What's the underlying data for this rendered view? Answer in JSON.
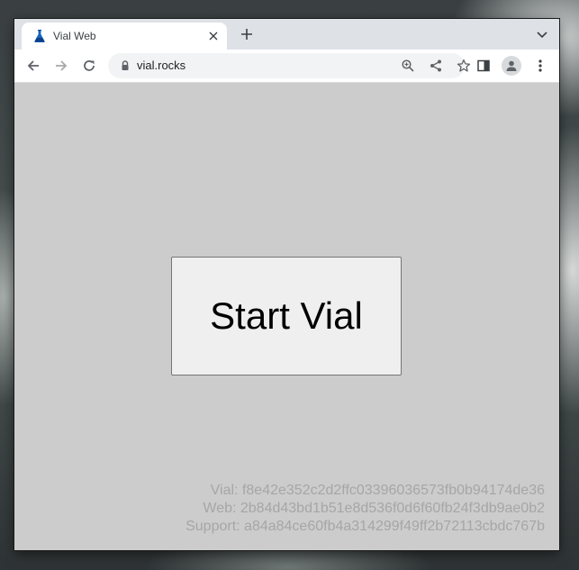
{
  "browser": {
    "tab": {
      "title": "Vial Web",
      "favicon": "flask-icon"
    },
    "address_bar": {
      "url": "vial.rocks"
    },
    "colors": {
      "tab_strip": "#dee1e6",
      "toolbar": "#ffffff",
      "icon": "#5f6368"
    }
  },
  "page": {
    "background": "#cccccc",
    "start_button_label": "Start Vial",
    "versions": [
      {
        "label": "Vial: f8e42e352c2d2ffc03396036573fb0b94174de36"
      },
      {
        "label": "Web: 2b84d43bd1b51e8d536f0d6f60fb24f3db9ae0b2"
      },
      {
        "label": "Support: a84a84ce60fb4a314299f49ff2b72113cbdc767b"
      }
    ]
  }
}
